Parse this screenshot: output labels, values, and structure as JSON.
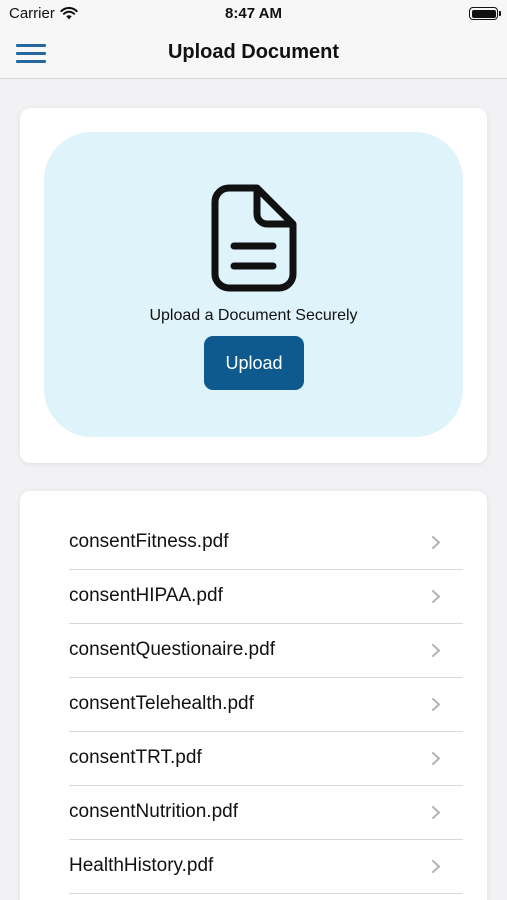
{
  "status_bar": {
    "carrier": "Carrier",
    "time": "8:47 AM"
  },
  "nav": {
    "title": "Upload Document",
    "accent_color": "#2368a2"
  },
  "upload": {
    "caption": "Upload a Document Securely",
    "button_label": "Upload",
    "zone_color": "#def3fa",
    "button_color": "#0e5a8e",
    "icon": "document-icon"
  },
  "documents": [
    {
      "name": "consentFitness.pdf"
    },
    {
      "name": "consentHIPAA.pdf"
    },
    {
      "name": "consentQuestionaire.pdf"
    },
    {
      "name": "consentTelehealth.pdf"
    },
    {
      "name": "consentTRT.pdf"
    },
    {
      "name": "consentNutrition.pdf"
    },
    {
      "name": "HealthHistory.pdf"
    }
  ]
}
